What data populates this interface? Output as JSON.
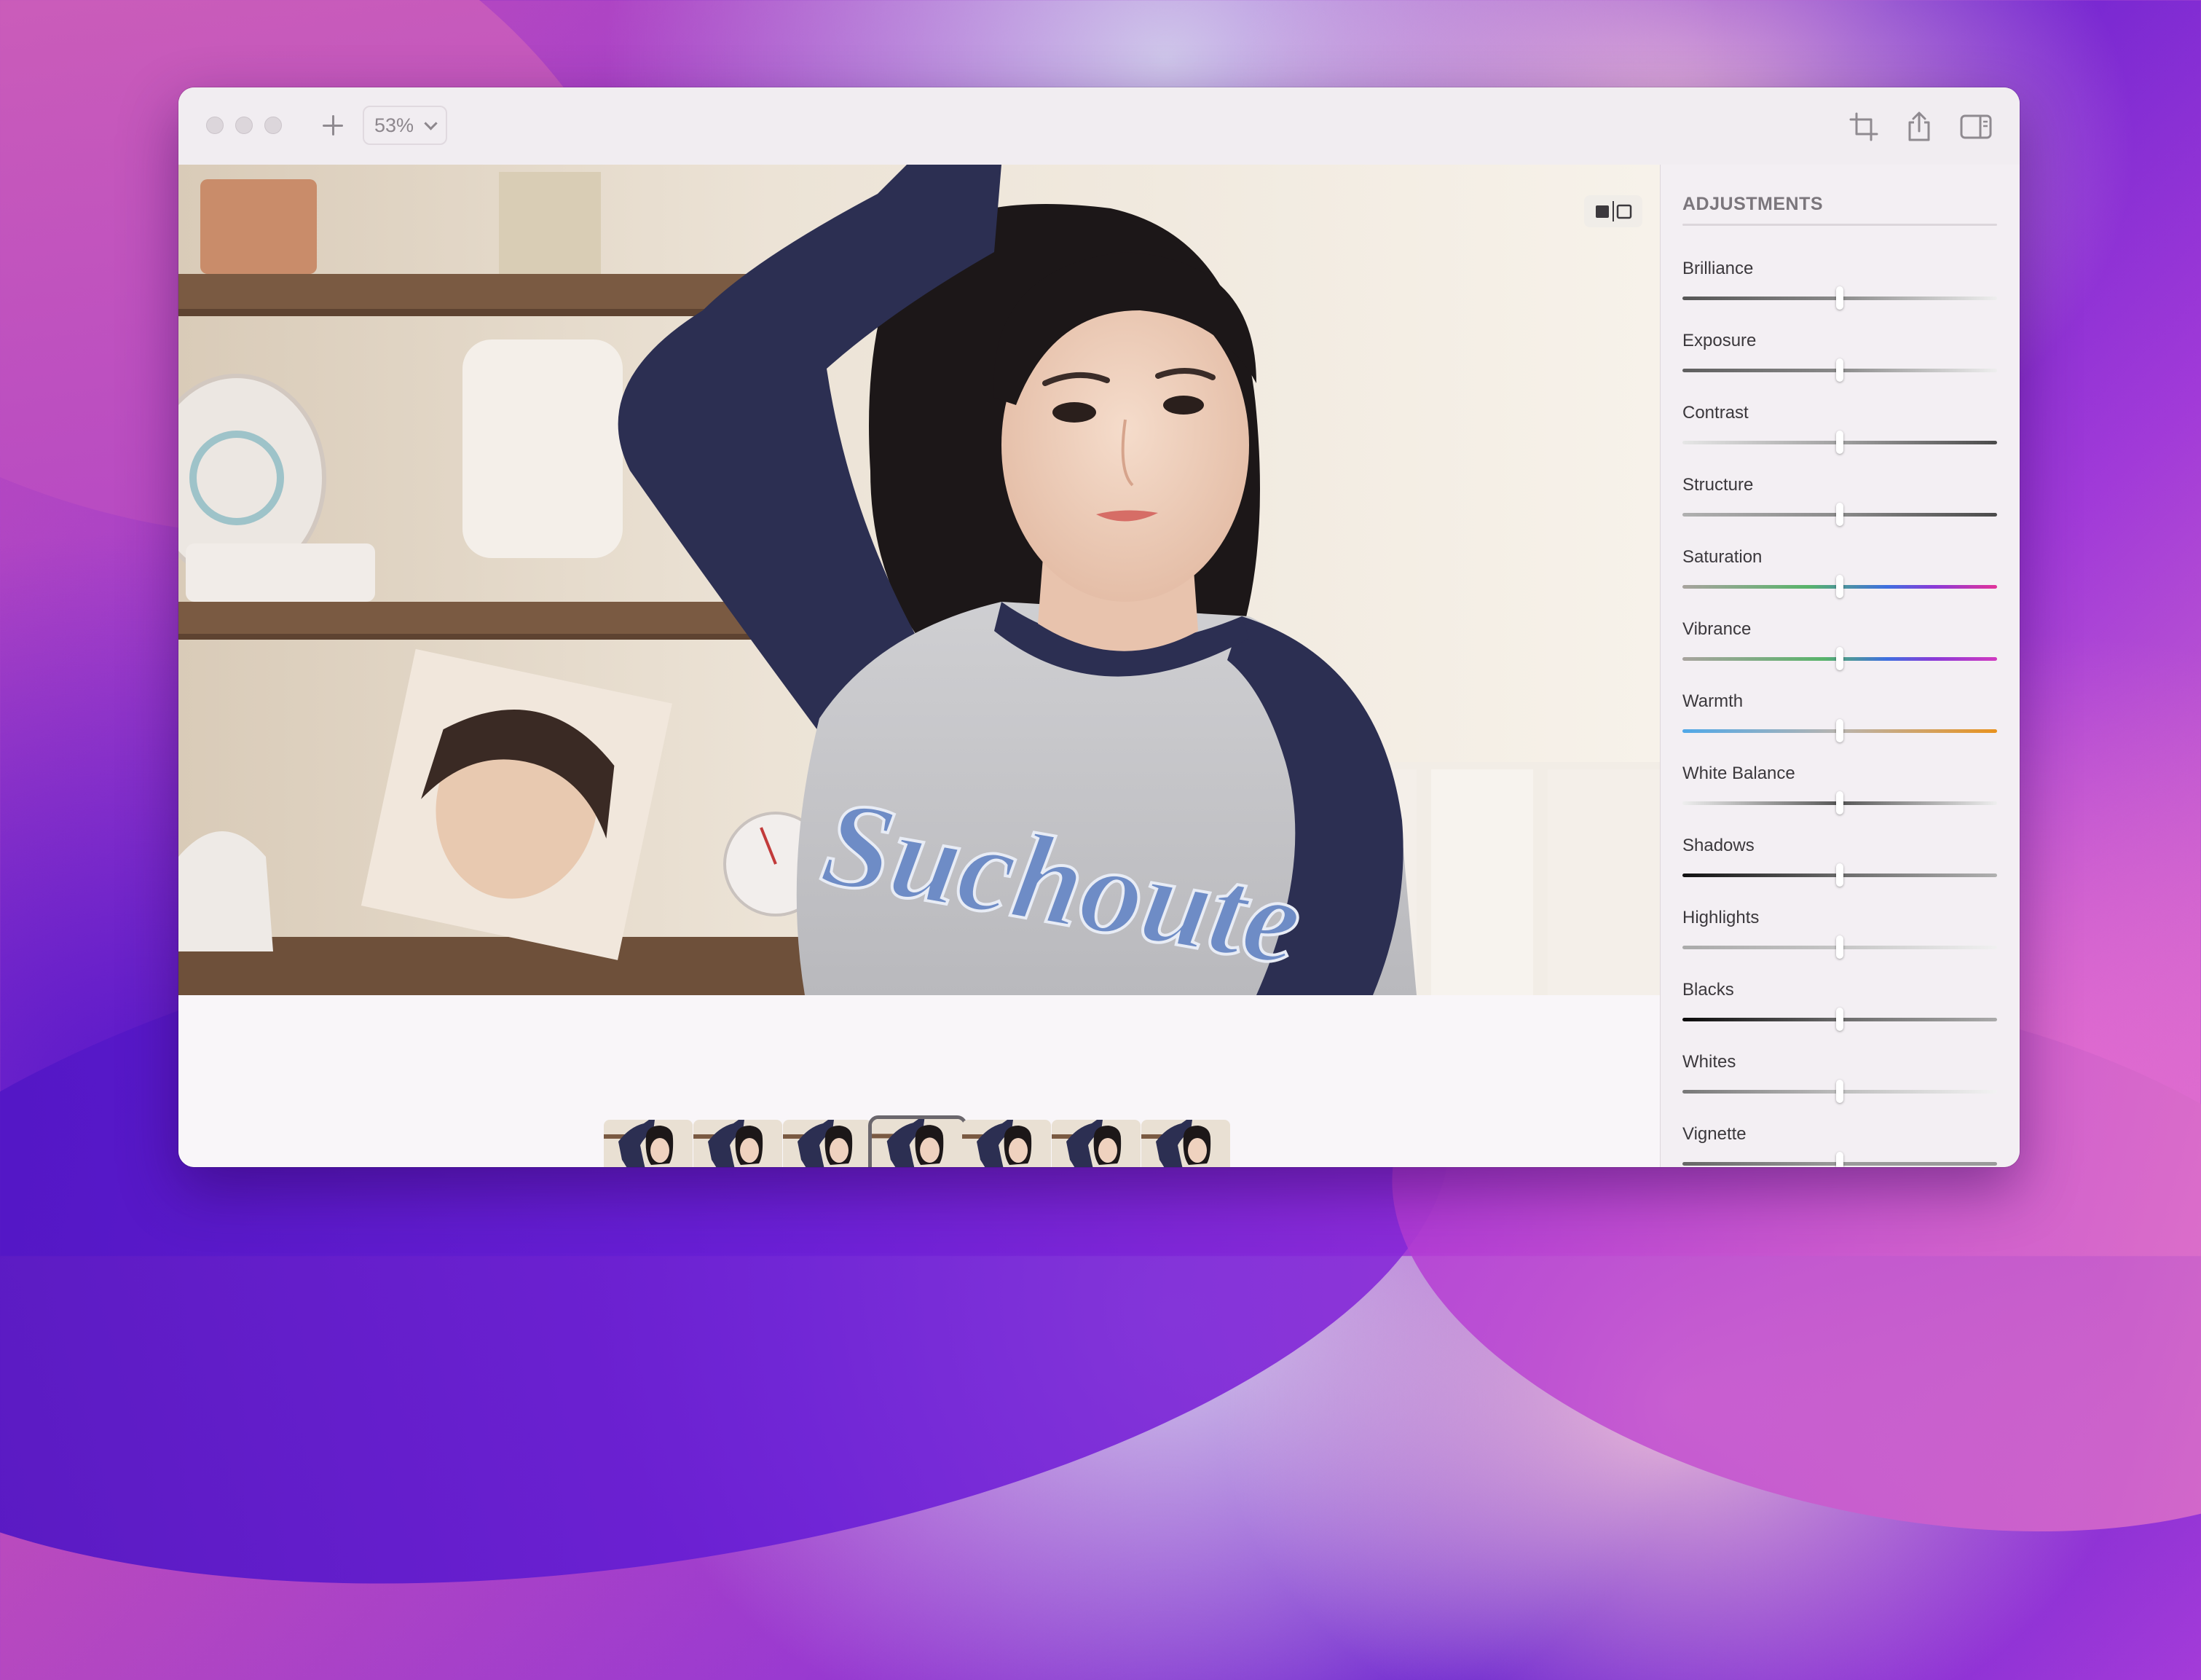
{
  "toolbar": {
    "zoom_value": "53%"
  },
  "adjustments": {
    "title": "ADJUSTMENTS",
    "items": [
      {
        "label": "Brilliance",
        "value": 0.5
      },
      {
        "label": "Exposure",
        "value": 0.5
      },
      {
        "label": "Contrast",
        "value": 0.5
      },
      {
        "label": "Structure",
        "value": 0.5
      },
      {
        "label": "Saturation",
        "value": 0.5
      },
      {
        "label": "Vibrance",
        "value": 0.5
      },
      {
        "label": "Warmth",
        "value": 0.5
      },
      {
        "label": "White Balance",
        "value": 0.5
      },
      {
        "label": "Shadows",
        "value": 0.5
      },
      {
        "label": "Highlights",
        "value": 0.5
      },
      {
        "label": "Blacks",
        "value": 0.5
      },
      {
        "label": "Whites",
        "value": 0.5
      },
      {
        "label": "Vignette",
        "value": 0.5
      }
    ]
  },
  "filmstrip": {
    "count": 7,
    "selected_index": 3
  },
  "colors": {
    "window_bg": "#f6f3f6",
    "icon_gray": "#8f8a90",
    "saturation_gradient": [
      "#a8a39e",
      "#58b36a",
      "#3e6fe0",
      "#8a3ad8",
      "#e2339a"
    ],
    "warmth_gradient": [
      "#4fa8e8",
      "#b9b4ae",
      "#e8921e"
    ]
  }
}
